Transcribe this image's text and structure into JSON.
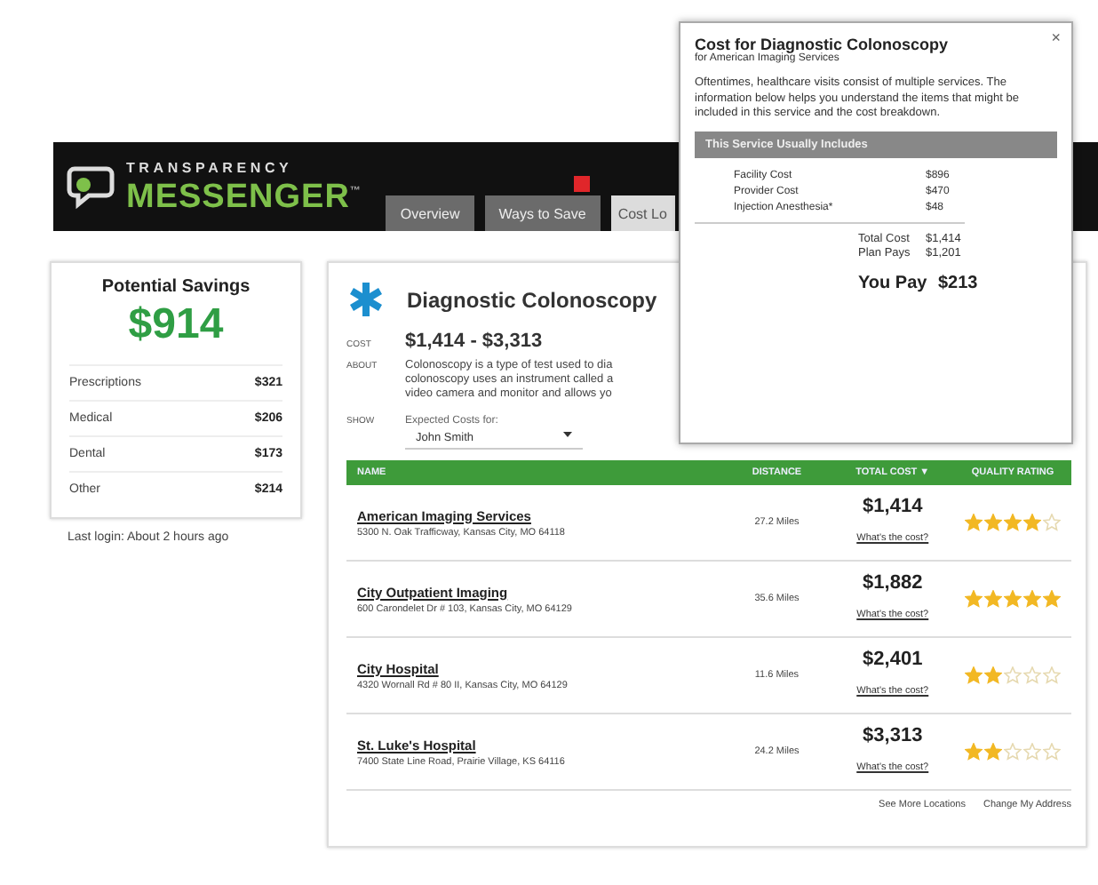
{
  "header": {
    "logo_top": "TRANSPARENCY",
    "logo_bottom": "MESSENGER",
    "logo_mark": "™"
  },
  "tabs": [
    {
      "label": "Overview",
      "selected": false,
      "badge": false
    },
    {
      "label": "Ways to Save",
      "selected": false,
      "badge": true
    },
    {
      "label": "Cost Lo",
      "selected": true,
      "badge": false
    }
  ],
  "savings": {
    "title": "Potential Savings",
    "amount": "$914",
    "items": [
      {
        "label": "Prescriptions",
        "value": "$321"
      },
      {
        "label": "Medical",
        "value": "$206"
      },
      {
        "label": "Dental",
        "value": "$173"
      },
      {
        "label": "Other",
        "value": "$214"
      }
    ],
    "last_login": "Last login: About 2 hours ago"
  },
  "procedure": {
    "title": "Diagnostic Colonoscopy",
    "cost_label": "COST",
    "cost": "$1,414 - $3,313",
    "about_label": "ABOUT",
    "about_lines": [
      "Colonoscopy is a type of test used to dia",
      "colonoscopy uses an instrument called a",
      "video camera and monitor and allows yo"
    ],
    "show_label": "SHOW",
    "select_label": "Expected Costs for:",
    "select_value": "John Smith"
  },
  "table": {
    "columns": [
      "NAME",
      "DISTANCE",
      "TOTAL COST ▼",
      "QUALITY RATING"
    ],
    "rows": [
      {
        "name": "American Imaging Services",
        "address": "5300 N. Oak Trafficway, Kansas City, MO 64118",
        "distance": "27.2 Miles",
        "cost": "$1,414",
        "link": "What's the cost?",
        "stars": 4
      },
      {
        "name": "City Outpatient Imaging",
        "address": "600 Carondelet Dr # 103, Kansas City, MO 64129",
        "distance": "35.6 Miles",
        "cost": "$1,882",
        "link": "What's the cost?",
        "stars": 5
      },
      {
        "name": "City Hospital",
        "address": "4320 Wornall Rd # 80 II, Kansas City, MO 64129",
        "distance": "11.6 Miles",
        "cost": "$2,401",
        "link": "What's the cost?",
        "stars": 2
      },
      {
        "name": "St. Luke's Hospital",
        "address": "7400 State Line Road, Prairie Village, KS 64116",
        "distance": "24.2 Miles",
        "cost": "$3,313",
        "link": "What's the cost?",
        "stars": 2
      }
    ],
    "footer_links": [
      "See More Locations",
      "Change My Address"
    ]
  },
  "popup": {
    "close": "×",
    "title": "Cost for Diagnostic Colonoscopy",
    "subtitle": "for American Imaging Services",
    "intro": "Oftentimes, healthcare visits consist of multiple services. The information below helps you understand the items that might be included in this service and the cost breakdown.",
    "section": "This Service Usually Includes",
    "items": [
      {
        "label": "Facility Cost",
        "value": "$896"
      },
      {
        "label": "Provider Cost",
        "value": "$470"
      },
      {
        "label": "Injection Anesthesia*",
        "value": "$48"
      }
    ],
    "totals": [
      {
        "label": "Total Cost",
        "value": "$1,414"
      },
      {
        "label": "Plan Pays",
        "value": "$1,201"
      }
    ],
    "you_pay_label": "You Pay",
    "you_pay": "$213"
  }
}
